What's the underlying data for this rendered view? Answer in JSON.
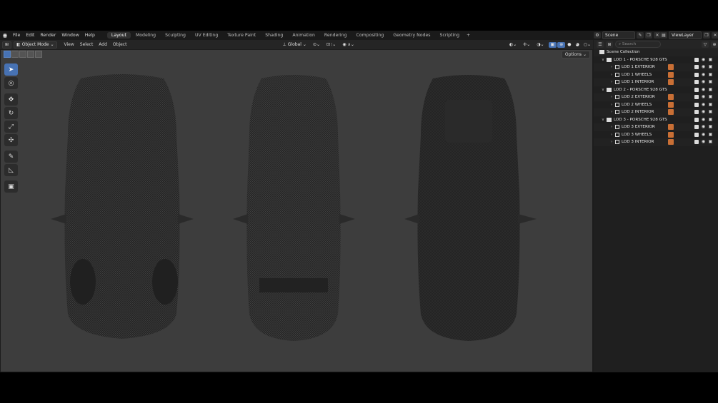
{
  "topbar": {
    "menus": [
      "File",
      "Edit",
      "Render",
      "Window",
      "Help"
    ],
    "workspaces": [
      "Layout",
      "Modeling",
      "Sculpting",
      "UV Editing",
      "Texture Paint",
      "Shading",
      "Animation",
      "Rendering",
      "Compositing",
      "Geometry Nodes",
      "Scripting"
    ],
    "active_workspace": "Layout",
    "add_tab": "+",
    "scene_label": "Scene",
    "viewlayer_label": "ViewLayer"
  },
  "viewport_header": {
    "mode": "Object Mode",
    "menus": [
      "View",
      "Select",
      "Add",
      "Object"
    ],
    "orientation": "Global",
    "options_label": "Options"
  },
  "outliner": {
    "search_placeholder": "Search",
    "scene_collection": "Scene Collection",
    "collections": [
      {
        "name": "LOD 1 - PORSCHE 928 GTS",
        "children": [
          {
            "name": "LOD 1 EXTERIOR"
          },
          {
            "name": "LOD 1 WHEELS"
          },
          {
            "name": "LOD 1 INTERIOR"
          }
        ]
      },
      {
        "name": "LOD 2 - PORSCHE 928 GTS",
        "children": [
          {
            "name": "LOD 2 EXTERIOR"
          },
          {
            "name": "LOD 2 WHEELS"
          },
          {
            "name": "LOD 2 INTERIOR"
          }
        ]
      },
      {
        "name": "LOD 3 - PORSCHE 928 GTS",
        "children": [
          {
            "name": "LOD 3 EXTERIOR"
          },
          {
            "name": "LOD 3 WHEELS"
          },
          {
            "name": "LOD 3 INTERIOR"
          }
        ]
      }
    ]
  },
  "tools": [
    "select-box-icon",
    "cursor-icon",
    "move-icon",
    "rotate-icon",
    "scale-icon",
    "transform-icon",
    "annotate-icon",
    "measure-icon",
    "add-cube-icon"
  ],
  "colors": {
    "accent": "#4772b3",
    "viewport_bg": "#3d3d3d",
    "modifier": "#c96f35"
  }
}
